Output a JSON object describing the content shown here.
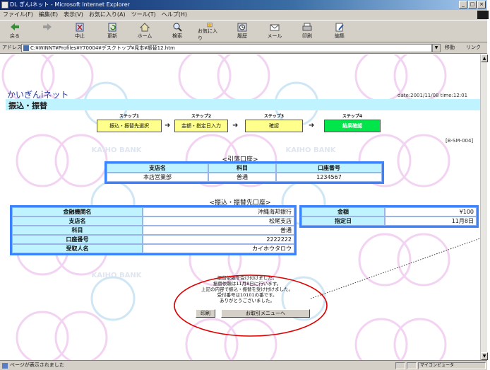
{
  "window": {
    "title": "DL ぎんiネット - Microsoft Internet Explorer",
    "controls": [
      "_",
      "□",
      "×"
    ]
  },
  "menu": [
    "ファイル(F)",
    "編集(E)",
    "表示(V)",
    "お気に入り(A)",
    "ツール(T)",
    "ヘルプ(H)"
  ],
  "toolbar": [
    {
      "label": "戻る",
      "icon": "back-arrow-icon"
    },
    {
      "label": "",
      "icon": "forward-arrow-icon"
    },
    {
      "label": "中止",
      "icon": "stop-icon"
    },
    {
      "label": "更新",
      "icon": "refresh-icon"
    },
    {
      "label": "ホーム",
      "icon": "home-icon"
    },
    {
      "label": "検索",
      "icon": "search-icon"
    },
    {
      "label": "お気に入り",
      "icon": "favorites-icon"
    },
    {
      "label": "履歴",
      "icon": "history-icon"
    },
    {
      "label": "メール",
      "icon": "mail-icon"
    },
    {
      "label": "印刷",
      "icon": "print-icon"
    },
    {
      "label": "編集",
      "icon": "edit-icon"
    }
  ],
  "address": {
    "label": "アドレス(D)",
    "value": "C:¥WINNT¥Profiles¥Y70004¥デスクトップ¥見本¥振替12.htm",
    "go_label": "移動",
    "links_label": "リンク"
  },
  "page": {
    "date_line": "date:2001/11/08 time:12:01",
    "site_title": "かいぎんiネット",
    "section_title": "振込・振替",
    "steps": [
      {
        "label": "ステップ1",
        "text": "振込・振替先選択",
        "current": false
      },
      {
        "label": "ステップ2",
        "text": "金額・指定日入力",
        "current": false
      },
      {
        "label": "ステップ3",
        "text": "確認",
        "current": false
      },
      {
        "label": "ステップ4",
        "text": "結果確認",
        "current": true
      }
    ],
    "page_code": "[B-SM-004]",
    "watermark_text": "KAIHO BANK",
    "from_account": {
      "title": "<引落口座>",
      "headers": [
        "支店名",
        "科目",
        "口座番号"
      ],
      "row": [
        "本店営業部",
        "普通",
        "1234567"
      ]
    },
    "to_account": {
      "title": "<振込・振替先口座>",
      "rows": [
        {
          "label": "金融機関名",
          "value": "沖縄海邦銀行"
        },
        {
          "label": "支店名",
          "value": "松尾支店"
        },
        {
          "label": "科目",
          "value": "普通"
        },
        {
          "label": "口座番号",
          "value": "2222222"
        },
        {
          "label": "受取人名",
          "value": "カイホウタロウ"
        }
      ],
      "side_rows": [
        {
          "label": "金額",
          "value": "¥100"
        },
        {
          "label": "指定日",
          "value": "11月8日"
        }
      ]
    },
    "result_message": [
      "振替依頼を受け付けました。",
      "振替依頼は11月8日に行います。",
      "上記の内容で振込・振替を受け付けました。",
      "受付番号は10101の番です。",
      "ありがとうございました。"
    ],
    "buttons": {
      "print": "印刷",
      "back_to_menu": "お取引メニューへ"
    }
  },
  "status": {
    "text": "ページが表示されました",
    "zone": "マイコンピュータ"
  },
  "colors": {
    "table_border": "#3b82ff",
    "header_fill": "#bff3ff",
    "current_step": "#00e64a",
    "step_fill": "#ffff8c",
    "highlight_oval": "#e00000"
  }
}
